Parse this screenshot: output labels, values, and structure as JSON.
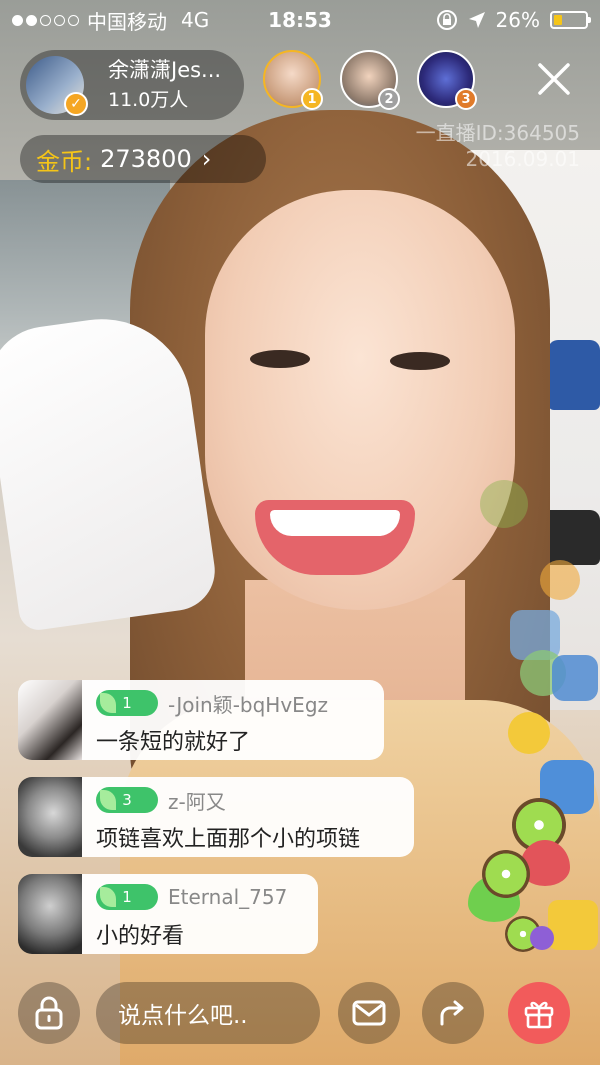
{
  "status_bar": {
    "signal_filled": 2,
    "signal_total": 5,
    "carrier": "中国移动",
    "network": "4G",
    "time": "18:53",
    "battery_percent_text": "26%",
    "battery_level": 0.26
  },
  "host": {
    "name": "余潇潇Jes...",
    "followers": "11.0万人",
    "verified_icon": "v-badge-icon"
  },
  "top_viewers": [
    {
      "rank": "1",
      "badge_color": "#f5b623"
    },
    {
      "rank": "2",
      "badge_color": "#a0a0a0"
    },
    {
      "rank": "3",
      "badge_color": "#e07b2a"
    }
  ],
  "coins": {
    "label": "金币:",
    "value": "273800",
    "arrow": "›"
  },
  "watermark": {
    "line1": "一直播ID:364505",
    "line2": "2016.09.01"
  },
  "chat": [
    {
      "level": "1",
      "user": "-Join颖-bqHvEgz",
      "message": "一条短的就好了"
    },
    {
      "level": "3",
      "user": "z-阿又",
      "message": "项链喜欢上面那个小的项链"
    },
    {
      "level": "1",
      "user": "Eternal_757",
      "message": "小的好看"
    }
  ],
  "input": {
    "placeholder": "说点什么吧.."
  },
  "colors": {
    "coin_label": "#f5c518",
    "level_badge": "#3ec36a",
    "gift_button": "#f25b5b",
    "battery": "#f5c518"
  }
}
